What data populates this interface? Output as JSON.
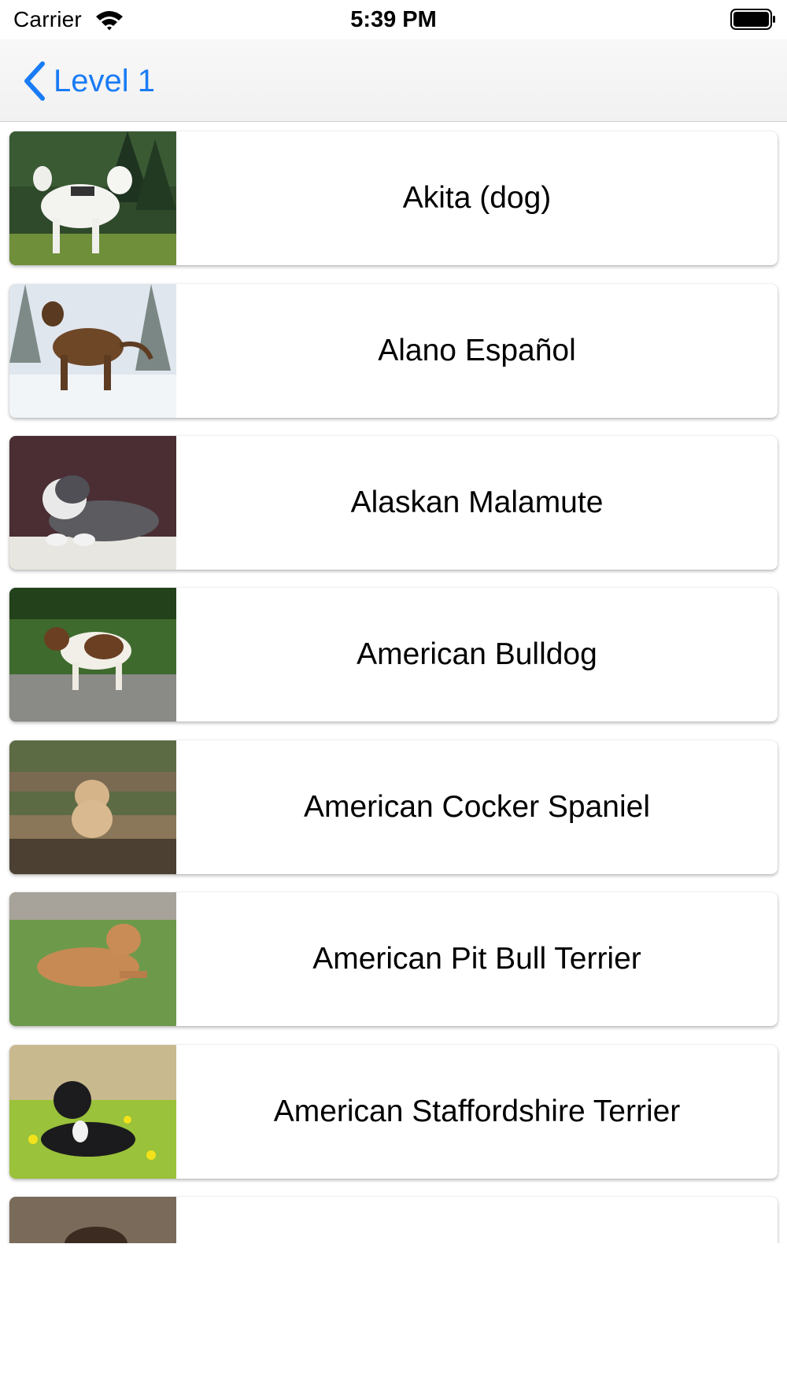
{
  "status_bar": {
    "carrier": "Carrier",
    "time": "5:39 PM",
    "icons": [
      "wifi-icon",
      "battery-icon"
    ]
  },
  "nav_bar": {
    "back_label": "Level 1",
    "back_icon": "chevron-left-icon",
    "accent_color": "#1a7cf5"
  },
  "breeds": [
    {
      "name": "Akita (dog)",
      "image": "akita-photo"
    },
    {
      "name": "Alano Español",
      "image": "alano-espanol-photo"
    },
    {
      "name": "Alaskan Malamute",
      "image": "alaskan-malamute-photo"
    },
    {
      "name": "American Bulldog",
      "image": "american-bulldog-photo"
    },
    {
      "name": "American Cocker Spaniel",
      "image": "american-cocker-spaniel-photo"
    },
    {
      "name": "American Pit Bull Terrier",
      "image": "american-pit-bull-terrier-photo"
    },
    {
      "name": "American Staffordshire Terrier",
      "image": "american-staffordshire-terrier-photo"
    },
    {
      "name": "",
      "image": "dog-photo"
    }
  ]
}
